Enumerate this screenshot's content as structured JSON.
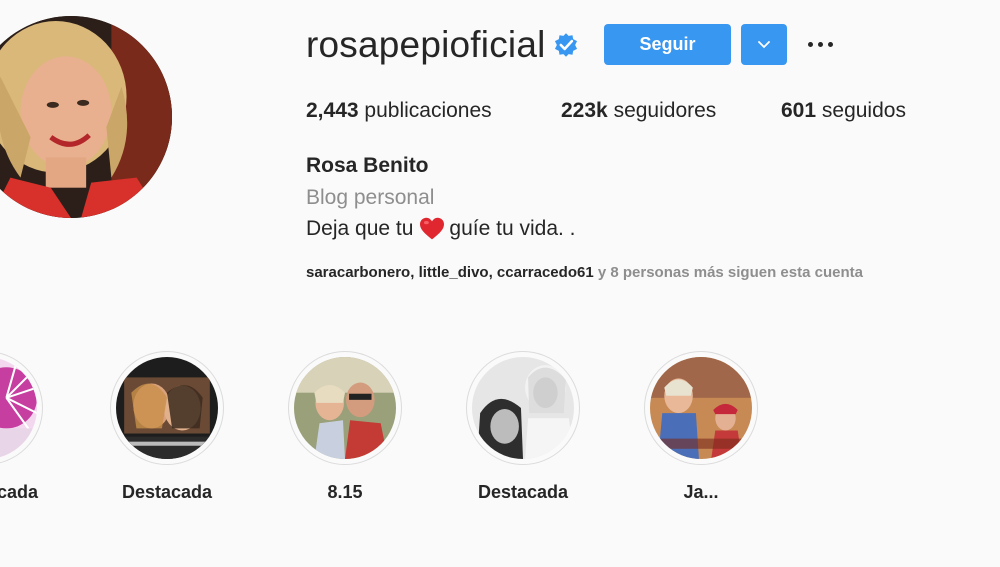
{
  "profile": {
    "username": "rosapepioficial",
    "verified_icon": "verified-badge-icon",
    "follow_label": "Seguir",
    "dropdown_icon": "chevron-down-icon",
    "more_icon": "more-options-icon"
  },
  "stats": {
    "posts_count": "2,443",
    "posts_label": "publicaciones",
    "followers_count": "223k",
    "followers_label": "seguidores",
    "following_count": "601",
    "following_label": "seguidos"
  },
  "bio": {
    "full_name": "Rosa Benito",
    "category": "Blog personal",
    "text_before": "Deja que tu",
    "emoji": "red-heart",
    "text_after": "guíe tu vida. ."
  },
  "followed_by": {
    "users": [
      "saracarbonero",
      "little_divo",
      "ccarracedo61"
    ],
    "rest": "y 8 personas más siguen esta cuenta"
  },
  "highlights": [
    {
      "label": "...cada"
    },
    {
      "label": "Destacada"
    },
    {
      "label": "8.15"
    },
    {
      "label": "Destacada"
    },
    {
      "label": "Ja..."
    }
  ],
  "colors": {
    "accent": "#3897f0",
    "text": "#262626",
    "secondary_text": "#8e8e8e",
    "background": "#fafafa"
  }
}
